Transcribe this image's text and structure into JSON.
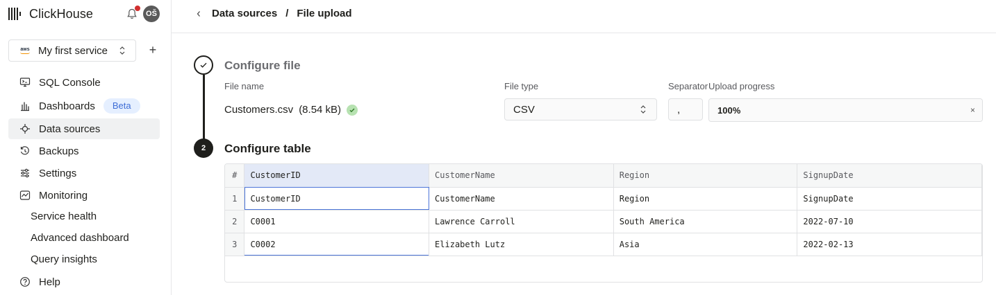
{
  "app": {
    "name": "ClickHouse",
    "avatar_initials": "OŠ",
    "notification_dot_color": "#d12f2f"
  },
  "service": {
    "provider_label": "aws",
    "name": "My first service"
  },
  "sidebar": {
    "items": [
      {
        "label": "SQL Console",
        "icon": "terminal-icon"
      },
      {
        "label": "Dashboards",
        "icon": "bar-chart-icon",
        "badge": "Beta"
      },
      {
        "label": "Data sources",
        "icon": "plug-icon",
        "active": true
      },
      {
        "label": "Backups",
        "icon": "history-icon"
      },
      {
        "label": "Settings",
        "icon": "sliders-icon"
      },
      {
        "label": "Monitoring",
        "icon": "monitor-icon"
      }
    ],
    "monitoring_children": [
      "Service health",
      "Advanced dashboard",
      "Query insights"
    ],
    "help_label": "Help"
  },
  "header": {
    "breadcrumb_parent": "Data sources",
    "breadcrumb_separator": "/",
    "breadcrumb_current": "File upload"
  },
  "steps": {
    "step1": {
      "title": "Configure file",
      "status": "complete"
    },
    "step2": {
      "title": "Configure table",
      "number": "2"
    }
  },
  "file": {
    "name_label": "File name",
    "name": "Customers.csv",
    "size": "(8.54 kB)",
    "type_label": "File type",
    "type_value": "CSV",
    "separator_label": "Separator",
    "separator_value": ",",
    "progress_label": "Upload progress",
    "progress_text": "100%",
    "progress_fraction": 1.0,
    "close_glyph": "×"
  },
  "table": {
    "rownum_header": "#",
    "columns": [
      "CustomerID",
      "CustomerName",
      "Region",
      "SignupDate"
    ],
    "rows": [
      {
        "n": "1",
        "cells": [
          "CustomerID",
          "CustomerName",
          "Region",
          "SignupDate"
        ]
      },
      {
        "n": "2",
        "cells": [
          "C0001",
          "Lawrence Carroll",
          "South America",
          "2022-07-10"
        ]
      },
      {
        "n": "3",
        "cells": [
          "C0002",
          "Elizabeth Lutz",
          "Asia",
          "2022-02-13"
        ]
      }
    ],
    "selected_column": 0,
    "accent_color": "#4b74d8"
  }
}
